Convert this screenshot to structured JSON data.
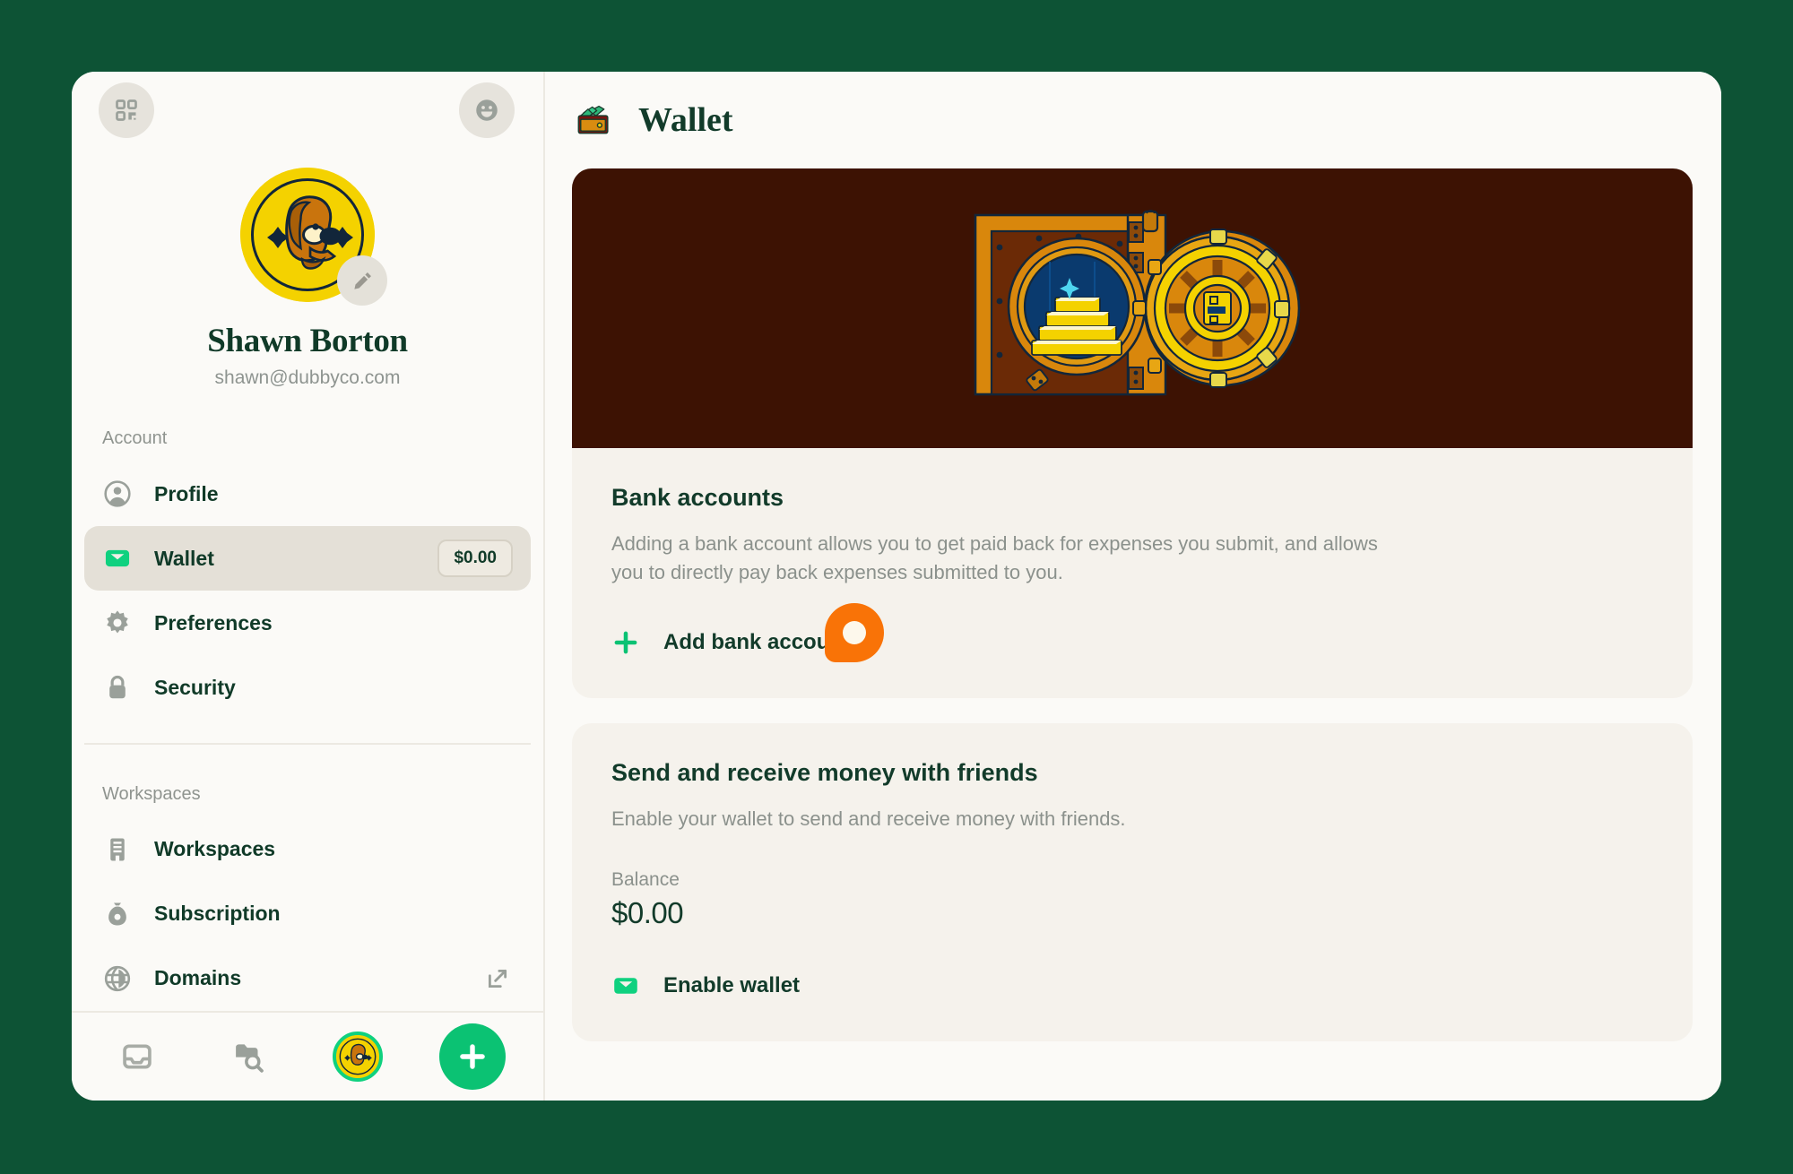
{
  "window": {
    "background_color": "#0d5335",
    "panel_color": "#fbfaf7"
  },
  "sidebar": {
    "topbar": {
      "grid_icon": "qr-grid-icon",
      "emoji_icon": "smiley-face-icon"
    },
    "profile": {
      "name": "Shawn Borton",
      "email": "shawn@dubbyco.com",
      "avatar_icon": "gold-coin-avatar",
      "edit_icon": "pencil-edit-icon"
    },
    "sections": [
      {
        "label": "Account",
        "items": [
          {
            "label": "Profile",
            "icon": "person-circle-icon",
            "active": false,
            "badge": null,
            "trailing_icon": null
          },
          {
            "label": "Wallet",
            "icon": "wallet-icon",
            "active": true,
            "badge": "$0.00",
            "trailing_icon": null
          },
          {
            "label": "Preferences",
            "icon": "gear-icon",
            "active": false,
            "badge": null,
            "trailing_icon": null
          },
          {
            "label": "Security",
            "icon": "lock-icon",
            "active": false,
            "badge": null,
            "trailing_icon": null
          }
        ]
      },
      {
        "label": "Workspaces",
        "items": [
          {
            "label": "Workspaces",
            "icon": "building-icon",
            "active": false,
            "badge": null,
            "trailing_icon": null
          },
          {
            "label": "Subscription",
            "icon": "money-bag-icon",
            "active": false,
            "badge": null,
            "trailing_icon": null
          },
          {
            "label": "Domains",
            "icon": "globe-icon",
            "active": false,
            "badge": null,
            "trailing_icon": "external-link-icon"
          }
        ]
      }
    ],
    "bottom_bar": {
      "inbox_icon": "inbox-icon",
      "search_icon": "search-folder-icon",
      "avatar_icon": "gold-coin-avatar",
      "add_icon": "plus-icon"
    }
  },
  "main": {
    "header": {
      "title": "Wallet",
      "icon": "wallet-cash-emoji"
    },
    "hero": {
      "illustration": "bank-vault-gold-illustration",
      "background_color": "#3d1203"
    },
    "cards": [
      {
        "title": "Bank accounts",
        "description": "Adding a bank account allows you to get paid back for expenses you submit, and allows you to directly pay back expenses submitted to you.",
        "action_label": "Add bank account",
        "action_icon": "plus-icon",
        "accent_color": "#0bc273"
      },
      {
        "title": "Send and receive money with friends",
        "description": "Enable your wallet to send and receive money with friends.",
        "balance_label": "Balance",
        "balance_value": "$0.00",
        "action_label": "Enable wallet",
        "action_icon": "wallet-icon",
        "accent_color": "#0fd17f"
      }
    ],
    "cursor": {
      "color": "#f97307"
    }
  }
}
